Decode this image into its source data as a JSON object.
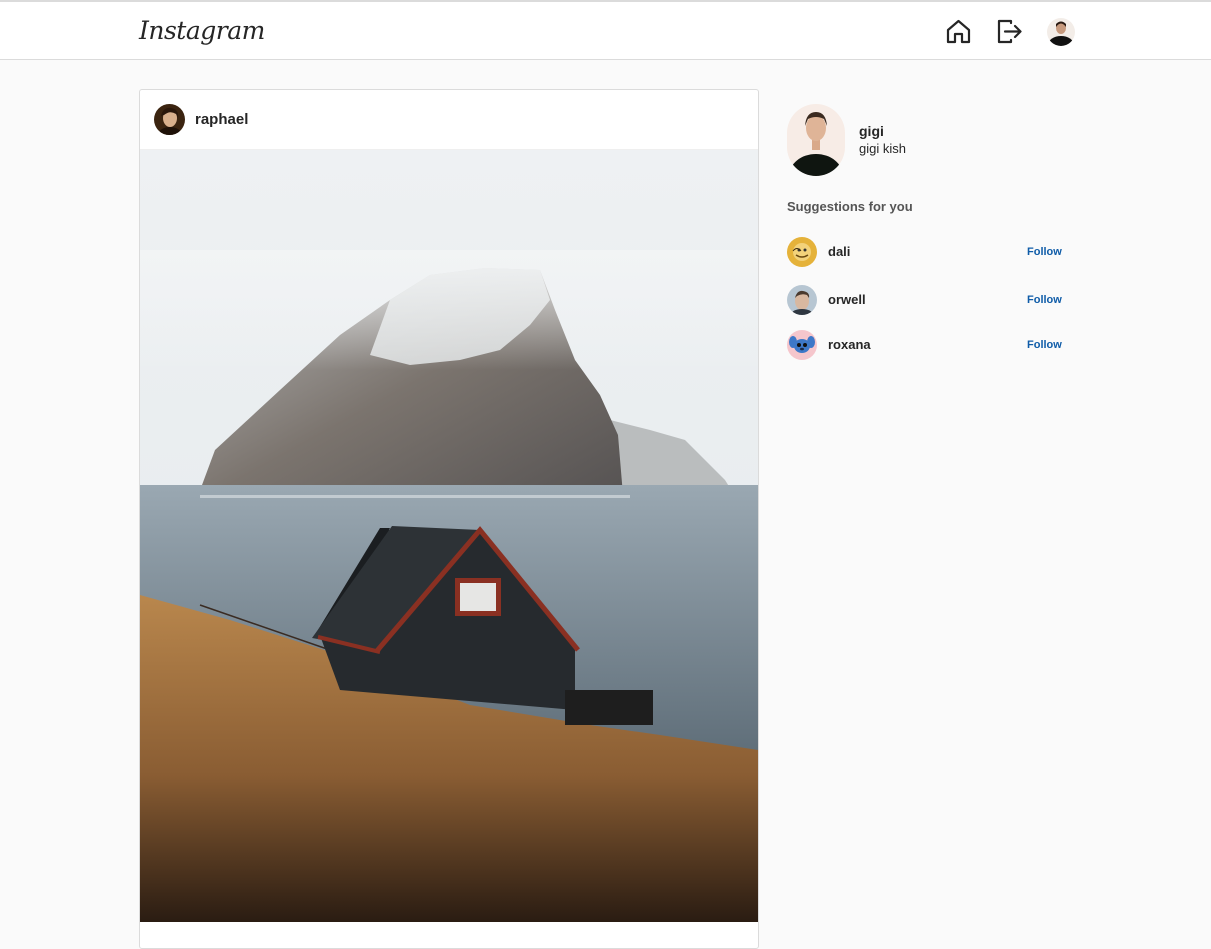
{
  "app": {
    "logo": "Instagram"
  },
  "nav": {
    "items": [
      {
        "icon": "home-icon"
      },
      {
        "icon": "logout-icon"
      },
      {
        "icon": "profile-avatar"
      }
    ]
  },
  "post": {
    "username": "raphael",
    "image": "landscape-photo"
  },
  "sidebar": {
    "me": {
      "username": "gigi",
      "full_name": "gigi kish"
    },
    "suggestions_title": "Suggestions for you",
    "suggestions": [
      {
        "username": "dali",
        "action": "Follow"
      },
      {
        "username": "orwell",
        "action": "Follow"
      },
      {
        "username": "roxana",
        "action": "Follow"
      }
    ]
  },
  "colors": {
    "accent": "#0f5ca8",
    "border": "#dbdbdb",
    "background": "#fafafa",
    "text": "#262626"
  }
}
